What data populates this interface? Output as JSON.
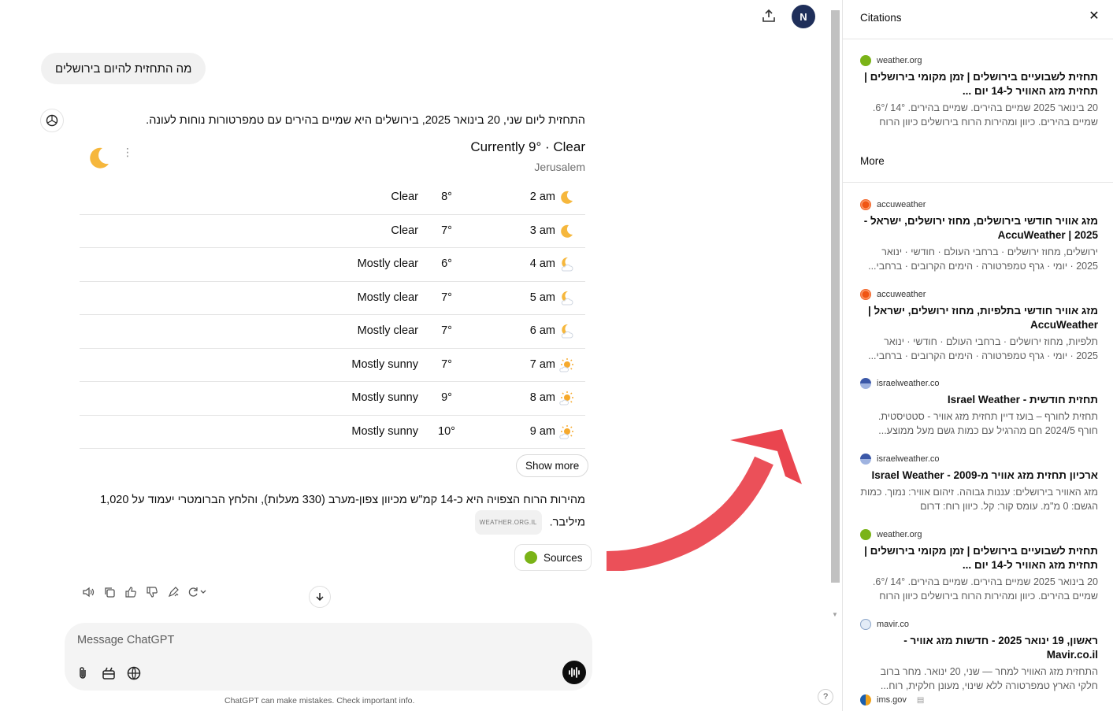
{
  "chat": {
    "user_message": "מה התחזית להיום בירושלים",
    "intro": "התחזית ליום שני, 20 בינואר 2025, בירושלים היא שמיים בהירים עם טמפרטורות נוחות לעונה.",
    "weather": {
      "currently": "Currently 9° · Clear",
      "location": "Jerusalem",
      "rows": [
        {
          "time": "2 am",
          "temp": "8°",
          "condition": "Clear",
          "icon": "moon-icon"
        },
        {
          "time": "3 am",
          "temp": "7°",
          "condition": "Clear",
          "icon": "moon-icon"
        },
        {
          "time": "4 am",
          "temp": "6°",
          "condition": "Mostly clear",
          "icon": "moon-cloud-icon"
        },
        {
          "time": "5 am",
          "temp": "7°",
          "condition": "Mostly clear",
          "icon": "moon-cloud-icon"
        },
        {
          "time": "6 am",
          "temp": "7°",
          "condition": "Mostly clear",
          "icon": "moon-cloud-icon"
        },
        {
          "time": "7 am",
          "temp": "7°",
          "condition": "Mostly sunny",
          "icon": "sun-cloud-icon"
        },
        {
          "time": "8 am",
          "temp": "9°",
          "condition": "Mostly sunny",
          "icon": "sun-cloud-icon"
        },
        {
          "time": "9 am",
          "temp": "10°",
          "condition": "Mostly sunny",
          "icon": "sun-cloud-icon"
        }
      ],
      "show_more": "Show more"
    },
    "wind_text": "מהירות הרוח הצפויה היא כ-14 קמ\"ש מכיוון צפון-מערב (330 מעלות), והלחץ הברומטרי יעמוד על 1,020 מיליבר.",
    "source_chip": "WEATHER.ORG.IL",
    "sources_label": "Sources",
    "composer_placeholder": "Message ChatGPT",
    "disclaimer": "ChatGPT can make mistakes. Check important info.",
    "avatar_initial": "N",
    "help": "?"
  },
  "colors": {
    "accent_red": "#e8313c",
    "moon": "#f6b73c",
    "weather_org": "#7ab317",
    "accuweather": "#f05514"
  },
  "citations": {
    "title": "Citations",
    "more_label": "More",
    "top": [
      {
        "source": "weather.org",
        "favicon": "green",
        "title": "תחזית לשבועיים בירושלים | זמן מקומי בירושלים | תחזית מזג האוויר ל-14 יום ...",
        "snippet": "20 בינואר 2025 שמיים בהירים. שמיים בהירים. 14° /6°. שמיים בהירים. כיוון ומהירות הרוח בירושלים כיוון הרוח"
      }
    ],
    "more": [
      {
        "source": "accuweather",
        "favicon": "orange",
        "title": "מזג אוויר חודשי בירושלים, מחוז ירושלים, ישראל - 2025 | AccuWeather",
        "snippet": "ירושלים, מחוז ירושלים · ברחבי העולם · חודשי · ינואר 2025 · יומי · גרף טמפרטורה · הימים הקרובים · ברחבי..."
      },
      {
        "source": "accuweather",
        "favicon": "orange",
        "title": "מזג אוויר חודשי בתלפיות, מחוז ירושלים, ישראל | AccuWeather",
        "snippet": "תלפיות, מחוז ירושלים · ברחבי העולם · חודשי · ינואר 2025 · יומי · גרף טמפרטורה · הימים הקרובים · ברחבי..."
      },
      {
        "source": "israelweather.co",
        "favicon": "blue",
        "title": "תחזית חודשית - Israel Weather",
        "snippet": "תחזית לחורף – בועז דיין תחזית מזג אוויר - סטטיסטית. חורף 2024/5 חם מהרגיל עם כמות גשם מעל ממוצע..."
      },
      {
        "source": "israelweather.co",
        "favicon": "blue",
        "title": "ארכיון תחזית מזג אוויר מ-2009 - Israel Weather",
        "snippet": "מזג האוויר בירושלים: עננות גבוהה. זיהום אוויר: נמוך. כמות הגשם: 0 מ\"מ. עומס קור: קל. כיוון רוח: דרום"
      },
      {
        "source": "weather.org",
        "favicon": "green",
        "title": "תחזית לשבועיים בירושלים | זמן מקומי בירושלים | תחזית מזג האוויר ל-14 יום ...",
        "snippet": "20 בינואר 2025 שמיים בהירים. שמיים בהירים. 14° /6°. שמיים בהירים. כיוון ומהירות הרוח בירושלים כיוון הרוח"
      },
      {
        "source": "mavir.co",
        "favicon": "cloud",
        "title": "ראשון, 19 ינואר 2025 - חדשות מזג אוויר - Mavir.co.il",
        "snippet": "התחזית מזג האוויר למחר — שני, 20 ינואר. מחר ברוב חלקי הארץ טמפרטורה ללא שינוי, מעונן חלקית, רוח..."
      },
      {
        "source": "ims.gov",
        "favicon": "ims",
        "title": "",
        "snippet": ""
      }
    ]
  }
}
